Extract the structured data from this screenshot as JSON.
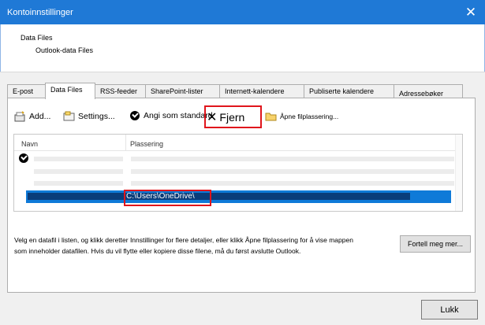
{
  "window": {
    "title": "Kontoinnstillinger",
    "close_glyph": "✕"
  },
  "header": {
    "heading": "Data Files",
    "subheading": "Outlook-data Files"
  },
  "tabs": [
    {
      "label": "E-post"
    },
    {
      "label": "Data Files",
      "active": true
    },
    {
      "label": "RSS-feeder"
    },
    {
      "label": "SharePoint-lister"
    },
    {
      "label": "Internett-kalendere"
    },
    {
      "label": "Publiserte kalendere"
    },
    {
      "label": "Adressebøker"
    }
  ],
  "toolbar": {
    "add": "Add...",
    "settings": "Settings...",
    "default": "Angi som standard",
    "remove": "Fjern",
    "open_location": "Åpne filplassering..."
  },
  "list": {
    "col_name": "Navn",
    "col_location": "Plassering",
    "selected_path": "C:\\Users\\OneDrive\\"
  },
  "description": "Velg en datafil i listen, og klikk deretter Innstillinger for flere detaljer, eller klikk Åpne filplassering for å vise mappen som inneholder datafilen. Hvis du vil flytte eller kopiere disse filene, må du først avslutte Outlook.",
  "buttons": {
    "tell_more": "Fortell meg mer...",
    "close": "Lukk"
  },
  "colors": {
    "titlebar": "#1f79d6",
    "selection": "#0f7ad8",
    "highlight_box": "#e0151c"
  },
  "icons": [
    "add-icon",
    "settings-icon",
    "check-icon",
    "remove-icon",
    "folder-icon"
  ]
}
